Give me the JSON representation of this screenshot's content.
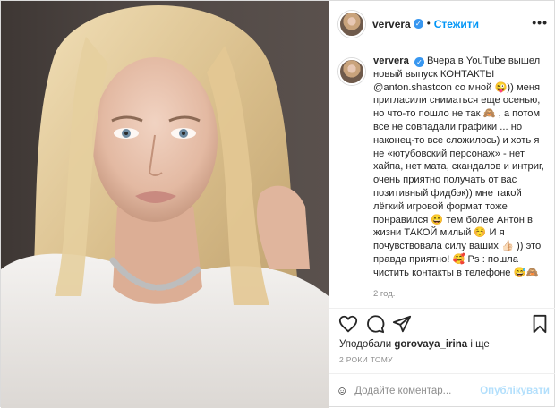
{
  "header": {
    "username": "ververa",
    "verified_mark": "✓",
    "separator": "•",
    "follow_label": "Стежити",
    "more_label": "•••"
  },
  "caption": {
    "username": "ververa",
    "text": "Вчера в YouTube вышел новый выпуск КОНТАКТЫ @anton.shastoon со мной 😜)) меня пригласили сниматься еще осенью, но что-то пошло не так 🙈 , а потом все не совпадали графики ... но наконец-то все сложилось) и хоть я не «ютубовский персонаж» - нет хайпа, нет мата, скандалов и интриг, очень приятно получать от вас позитивный фидбэк)) мне такой лёгкий игровой формат тоже понравился 😄 тем более Антон в жизни ТАКОЙ милый ☺️ И я почувствовала силу ваших 👍🏻 )) это правда приятно! 🥰 Ps : пошла чистить контакты в телефоне 😅🙈",
    "time": "2 год."
  },
  "actions": {
    "like_icon": "heart-icon",
    "comment_icon": "comment-icon",
    "share_icon": "paper-plane-icon",
    "save_icon": "bookmark-icon"
  },
  "likes": {
    "prefix": "Уподобали ",
    "user": "gorovaya_irina",
    "suffix": " і ще"
  },
  "post_time": "2 РОКИ ТОМУ",
  "comment": {
    "emoji_icon": "smiley-icon",
    "placeholder": "Додайте коментар...",
    "publish_label": "Опублікувати"
  },
  "colors": {
    "link_blue": "#0095f6",
    "verified_blue": "#3897f0",
    "publish_disabled": "#b2dffc",
    "muted": "#8e8e8e"
  }
}
